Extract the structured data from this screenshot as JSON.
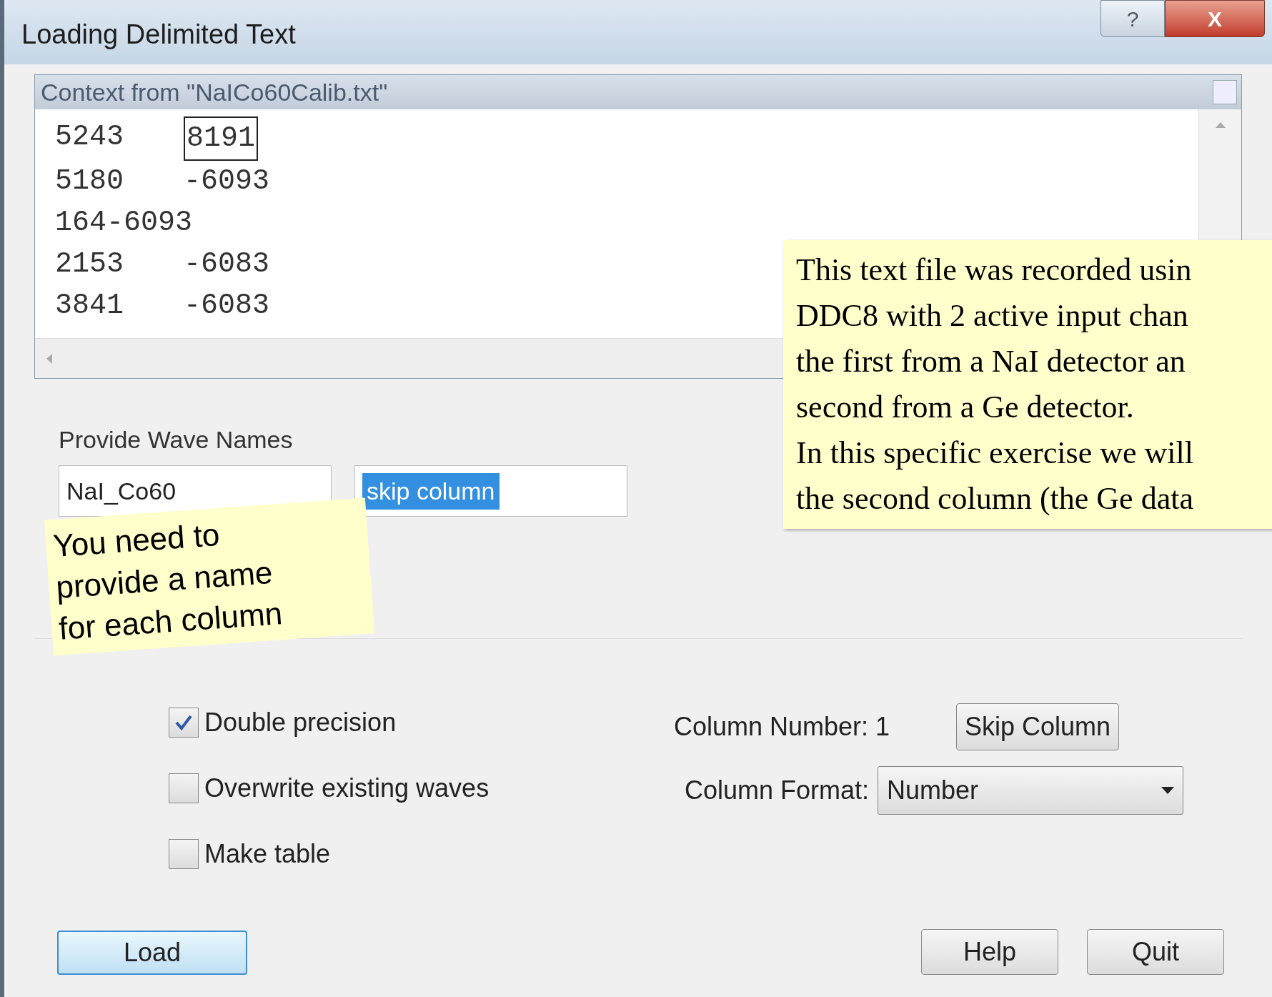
{
  "window": {
    "title": "Loading Delimited Text",
    "controls": [
      {
        "kind": "help",
        "label": "?"
      },
      {
        "kind": "close",
        "label": "X"
      }
    ]
  },
  "context": {
    "title": "Context from \"NaICo60Calib.txt\"",
    "rows": [
      [
        {
          "text": "5243",
          "selected": false
        },
        {
          "text": "8191",
          "selected": true
        }
      ],
      [
        {
          "text": "5180",
          "selected": false
        },
        {
          "text": "-6093",
          "selected": false
        }
      ],
      [
        {
          "text": "164-6093",
          "selected": false
        }
      ],
      [
        {
          "text": "2153",
          "selected": false
        },
        {
          "text": "-6083",
          "selected": false
        }
      ],
      [
        {
          "text": "3841",
          "selected": false
        },
        {
          "text": "-6083",
          "selected": false
        }
      ]
    ]
  },
  "wave_names": {
    "label": "Provide Wave Names",
    "fields": [
      {
        "value": "NaI_Co60",
        "highlighted": false
      },
      {
        "value": "skip column",
        "highlighted": true
      }
    ]
  },
  "options": [
    {
      "label": "Double precision",
      "checked": true
    },
    {
      "label": "Overwrite existing waves",
      "checked": false
    },
    {
      "label": "Make table",
      "checked": false
    }
  ],
  "column_number": {
    "label": "Column Number:",
    "value": "1"
  },
  "skip_button": "Skip Column",
  "column_format": {
    "label": "Column Format:",
    "value": "Number"
  },
  "buttons": [
    {
      "label": "Load",
      "kind": "default"
    },
    {
      "label": "Help",
      "kind": "normal"
    },
    {
      "label": "Quit",
      "kind": "normal"
    }
  ],
  "notes": [
    {
      "kind": "serif",
      "lines": [
        "This text file was recorded usin",
        "DDC8 with 2 active input chan",
        "the first from a NaI detector an",
        "second from a Ge detector.",
        "In this specific exercise we will",
        "the second column (the Ge data"
      ]
    },
    {
      "kind": "sans",
      "lines": [
        "You need to",
        "provide a name",
        "for each column"
      ]
    }
  ]
}
